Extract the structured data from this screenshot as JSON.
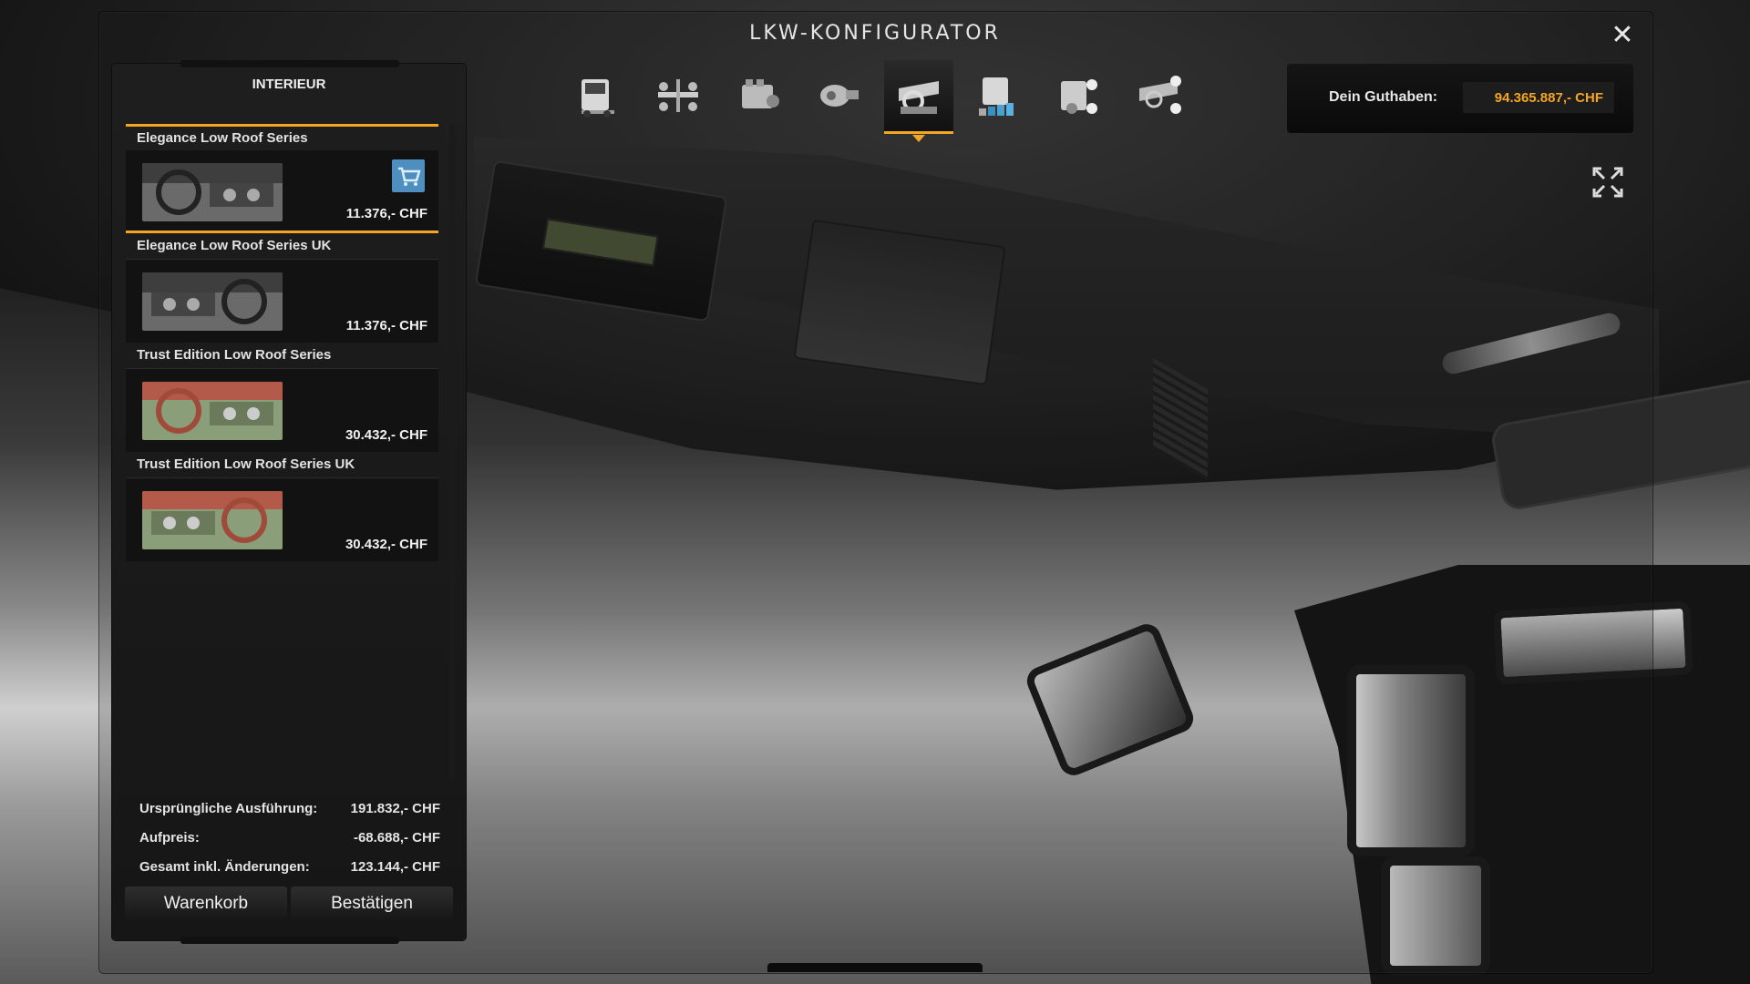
{
  "window": {
    "title": "LKW-KONFIGURATOR",
    "close_icon": "close-icon"
  },
  "toolbar": {
    "tabs": [
      {
        "name": "truck-icon",
        "active": false
      },
      {
        "name": "chassis-icon",
        "active": false
      },
      {
        "name": "engine-icon",
        "active": false
      },
      {
        "name": "transmission-icon",
        "active": false
      },
      {
        "name": "interior-icon",
        "active": true
      },
      {
        "name": "paint-icon",
        "active": false
      },
      {
        "name": "accessories-icon",
        "active": false
      },
      {
        "name": "interior-accessories-icon",
        "active": false
      }
    ]
  },
  "balance": {
    "label": "Dein Guthaben:",
    "value": "94.365.887,- CHF"
  },
  "panel": {
    "header": "INTERIEUR",
    "items": [
      {
        "name": "Elegance Low Roof Series",
        "price": "11.376,- CHF",
        "selected": true,
        "in_cart": true,
        "theme": "grey"
      },
      {
        "name": "Elegance Low Roof Series UK",
        "price": "11.376,- CHF",
        "selected": false,
        "theme": "grey"
      },
      {
        "name": "Trust Edition Low Roof Series",
        "price": "30.432,- CHF",
        "selected": false,
        "theme": "red"
      },
      {
        "name": "Trust Edition Low Roof Series UK",
        "price": "30.432,- CHF",
        "selected": false,
        "theme": "red"
      }
    ],
    "summary": {
      "original_label": "Ursprüngliche Ausführung:",
      "original_value": "191.832,- CHF",
      "surcharge_label": "Aufpreis:",
      "surcharge_value": "-68.688,- CHF",
      "total_label": "Gesamt inkl. Änderungen:",
      "total_value": "123.144,- CHF"
    },
    "buttons": {
      "cart": "Warenkorb",
      "confirm": "Bestätigen"
    }
  },
  "colors": {
    "accent": "#f2a623",
    "panel_bg": "#1a1a1a",
    "text": "#e6e6e6"
  }
}
